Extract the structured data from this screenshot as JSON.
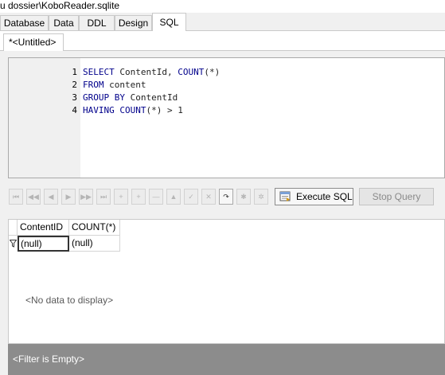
{
  "window": {
    "title": "u dossier\\KoboReader.sqlite"
  },
  "main_tabs": [
    {
      "label": "Database"
    },
    {
      "label": "Data"
    },
    {
      "label": "DDL"
    },
    {
      "label": "Design"
    },
    {
      "label": "SQL",
      "active": true
    }
  ],
  "doc_tab": {
    "label": "*<Untitled>"
  },
  "editor": {
    "lines": [
      {
        "num": "1",
        "tokens": [
          "SELECT",
          " ContentId, ",
          "COUNT",
          "(*)"
        ]
      },
      {
        "num": "2",
        "tokens": [
          "FROM",
          " content"
        ]
      },
      {
        "num": "3",
        "tokens": [
          "GROUP BY",
          " ContentId"
        ]
      },
      {
        "num": "4",
        "tokens": [
          "HAVING",
          " ",
          "COUNT",
          "(*) > 1"
        ]
      }
    ]
  },
  "toolbar": {
    "nav_icons": [
      "first-icon",
      "prior-page-icon",
      "prior-icon",
      "next-icon",
      "next-page-icon",
      "last-icon",
      "insert-icon",
      "append-icon",
      "delete-icon",
      "edit-icon",
      "post-icon",
      "cancel-icon",
      "refresh-icon",
      "bookmark-icon",
      "goto-bookmark-icon"
    ],
    "execute_label": "Execute SQL",
    "stop_label": "Stop Query"
  },
  "results": {
    "columns": [
      "ContentID",
      "COUNT(*)"
    ],
    "filter_values": [
      "(null)",
      "(null)"
    ],
    "empty_message": "<No data to display>",
    "filter_status": "<Filter is Empty>"
  },
  "colors": {
    "keyword": "#00008b",
    "footer_bg": "#8c8c8c",
    "panel_bg": "#f0f0f0"
  }
}
